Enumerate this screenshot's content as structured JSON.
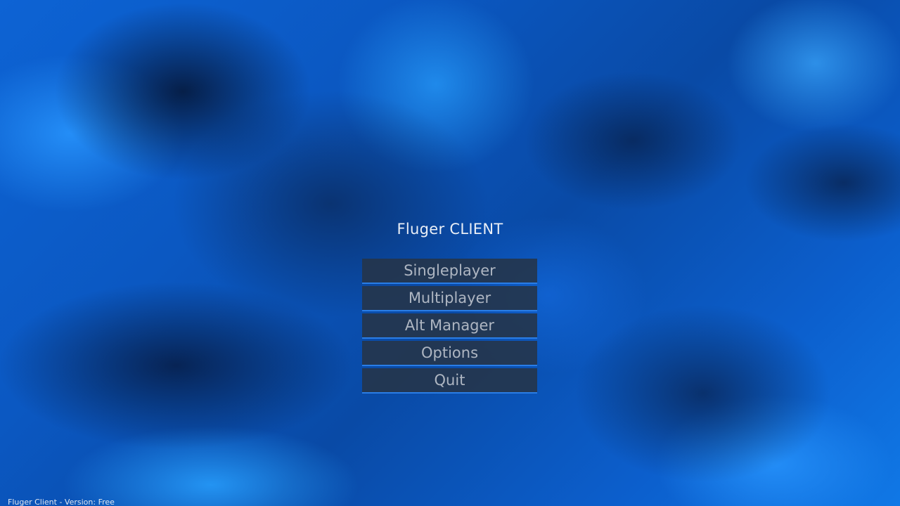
{
  "title": "Fluger CLIENT",
  "menu": {
    "singleplayer_label": "Singleplayer",
    "multiplayer_label": "Multiplayer",
    "alt_manager_label": "Alt Manager",
    "options_label": "Options",
    "quit_label": "Quit"
  },
  "footer": {
    "version_text": "Fluger Client - Version: Free"
  },
  "colors": {
    "accent": "#2a7de6",
    "button_bg": "#263448",
    "button_text": "#aeb6c2",
    "title_text": "#e9eef6"
  }
}
